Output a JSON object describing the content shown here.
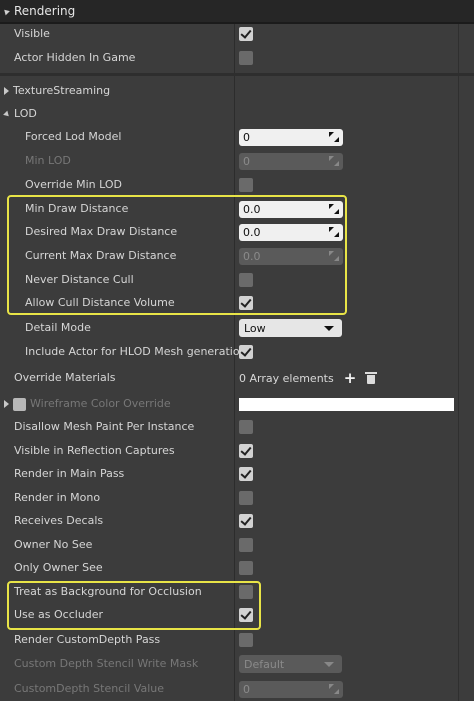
{
  "panel": {
    "title": "Rendering"
  },
  "rows": {
    "visible": {
      "label": "Visible",
      "checked": true
    },
    "actor_hidden": {
      "label": "Actor Hidden In Game",
      "checked": false
    },
    "texture_streaming": {
      "label": "TextureStreaming"
    },
    "lod": {
      "label": "LOD"
    },
    "forced_lod": {
      "label": "Forced Lod Model",
      "value": "0"
    },
    "min_lod": {
      "label": "Min LOD",
      "value": "0"
    },
    "override_min_lod": {
      "label": "Override Min LOD",
      "checked": false
    },
    "min_draw_distance": {
      "label": "Min Draw Distance",
      "value": "0.0"
    },
    "desired_max_draw": {
      "label": "Desired Max Draw Distance",
      "value": "0.0"
    },
    "current_max_draw": {
      "label": "Current Max Draw Distance",
      "value": "0.0"
    },
    "never_distance_cull": {
      "label": "Never Distance Cull",
      "checked": false
    },
    "allow_cull_volume": {
      "label": "Allow Cull Distance Volume",
      "checked": true
    },
    "detail_mode": {
      "label": "Detail Mode",
      "value": "Low"
    },
    "include_hlod": {
      "label": "Include Actor for HLOD Mesh generation",
      "checked": true
    },
    "override_materials": {
      "label": "Override Materials",
      "value": "0 Array elements"
    },
    "wireframe_color": {
      "label": "Wireframe Color Override",
      "color": "#ffffff"
    },
    "disallow_mesh_paint": {
      "label": "Disallow Mesh Paint Per Instance",
      "checked": false
    },
    "visible_reflection": {
      "label": "Visible in Reflection Captures",
      "checked": true
    },
    "render_main_pass": {
      "label": "Render in Main Pass",
      "checked": true
    },
    "render_mono": {
      "label": "Render in Mono",
      "checked": false
    },
    "receives_decals": {
      "label": "Receives Decals",
      "checked": true
    },
    "owner_no_see": {
      "label": "Owner No See",
      "checked": false
    },
    "only_owner_see": {
      "label": "Only Owner See",
      "checked": false
    },
    "treat_background": {
      "label": "Treat as Background for Occlusion",
      "checked": false
    },
    "use_as_occluder": {
      "label": "Use as Occluder",
      "checked": true
    },
    "render_custom_depth": {
      "label": "Render CustomDepth Pass",
      "checked": false
    },
    "stencil_write_mask": {
      "label": "Custom Depth Stencil Write Mask",
      "value": "Default"
    },
    "stencil_value": {
      "label": "CustomDepth Stencil Value",
      "value": "0"
    }
  },
  "colors": {
    "highlight": "#e8e447",
    "panel_bg": "#3c3c3c",
    "header_bg": "#262626"
  },
  "icons": {
    "add": "plus-icon",
    "delete": "trash-icon"
  }
}
